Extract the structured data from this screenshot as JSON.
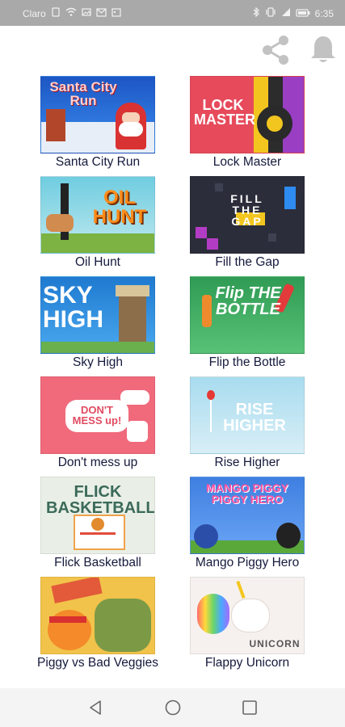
{
  "status": {
    "carrier": "Claro",
    "time": "6:35"
  },
  "toolbar": {
    "share_icon": "share-icon",
    "bell_icon": "bell-icon"
  },
  "games": [
    {
      "title": "Santa City Run",
      "thumb_text": "Santa City Run",
      "color": "#2a6fd6"
    },
    {
      "title": "Lock Master",
      "thumb_text": "LOCK MASTER",
      "color": "#e64a5b"
    },
    {
      "title": "Oil Hunt",
      "thumb_text": "OIL HUNT",
      "color": "#66c6d6"
    },
    {
      "title": "Fill the Gap",
      "thumb_text": "FILL THE GAP",
      "color": "#2b2d3a"
    },
    {
      "title": "Sky High",
      "thumb_text": "SKY HIGH",
      "color": "#2d86d6"
    },
    {
      "title": "Flip the Bottle",
      "thumb_text": "Flip THE BOTTLE",
      "color": "#3aa05a"
    },
    {
      "title": "Don't mess up",
      "thumb_text": "DON'T MESS up!",
      "color": "#f06a7c"
    },
    {
      "title": "Rise Higher",
      "thumb_text": "RISE HIGHER",
      "color": "#8fd0e8"
    },
    {
      "title": "Flick Basketball",
      "thumb_text": "FLICK BASKETBALL",
      "color": "#e9efe6"
    },
    {
      "title": "Mango Piggy Hero",
      "thumb_text": "MANGO PIGGY PIGGY HERO",
      "color": "#3f7fe0"
    },
    {
      "title": "Piggy vs Bad Veggies",
      "thumb_text": "",
      "color": "#f2c34a"
    },
    {
      "title": "Flappy Unicorn",
      "thumb_text": "UNICORN",
      "color": "#f6f1ee"
    }
  ],
  "nav": {
    "back_icon": "back-icon",
    "home_icon": "home-icon",
    "recents_icon": "recents-icon"
  }
}
